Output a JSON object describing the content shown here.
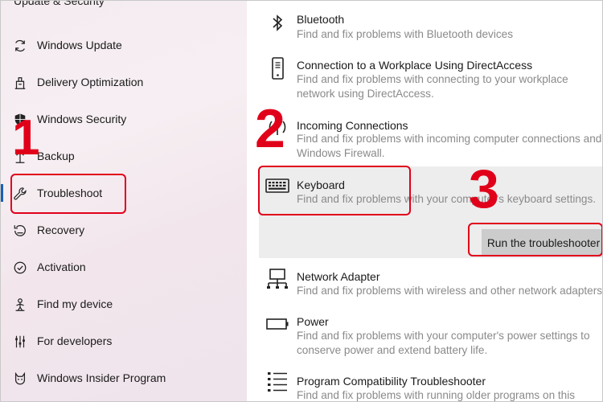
{
  "sidebar": {
    "title": "Update & Security",
    "items": [
      {
        "label": "Windows Update",
        "icon": "refresh-icon"
      },
      {
        "label": "Delivery Optimization",
        "icon": "delivery-optimization-icon"
      },
      {
        "label": "Windows Security",
        "icon": "shield-icon"
      },
      {
        "label": "Backup",
        "icon": "backup-arrow-icon"
      },
      {
        "label": "Troubleshoot",
        "icon": "wrench-icon"
      },
      {
        "label": "Recovery",
        "icon": "recovery-icon"
      },
      {
        "label": "Activation",
        "icon": "check-circle-icon"
      },
      {
        "label": "Find my device",
        "icon": "person-locate-icon"
      },
      {
        "label": "For developers",
        "icon": "developer-sliders-icon"
      },
      {
        "label": "Windows Insider Program",
        "icon": "cat-icon"
      }
    ]
  },
  "annotations": {
    "step1": "1",
    "step2": "2",
    "step3": "3",
    "accent_color": "#e1001a"
  },
  "troubleshooters": {
    "bluetooth": {
      "title": "Bluetooth",
      "desc": "Find and fix problems with Bluetooth devices",
      "icon": "bluetooth-icon"
    },
    "directaccess": {
      "title": "Connection to a Workplace Using DirectAccess",
      "desc": "Find and fix problems with connecting to your workplace network using DirectAccess.",
      "icon": "phone-device-icon"
    },
    "incoming": {
      "title": "Incoming Connections",
      "desc": "Find and fix problems with incoming computer connections and Windows Firewall.",
      "icon": "incoming-signal-icon"
    },
    "keyboard": {
      "title": "Keyboard",
      "desc": "Find and fix problems with your computer's keyboard settings.",
      "icon": "keyboard-icon",
      "run_button": "Run the troubleshooter"
    },
    "network": {
      "title": "Network Adapter",
      "desc": "Find and fix problems with wireless and other network adapters.",
      "icon": "network-adapter-icon"
    },
    "power": {
      "title": "Power",
      "desc": "Find and fix problems with your computer's power settings to conserve power and extend battery life.",
      "icon": "battery-icon"
    },
    "compat": {
      "title": "Program Compatibility Troubleshooter",
      "desc": "Find and fix problems with running older programs on this",
      "icon": "list-icon"
    }
  }
}
